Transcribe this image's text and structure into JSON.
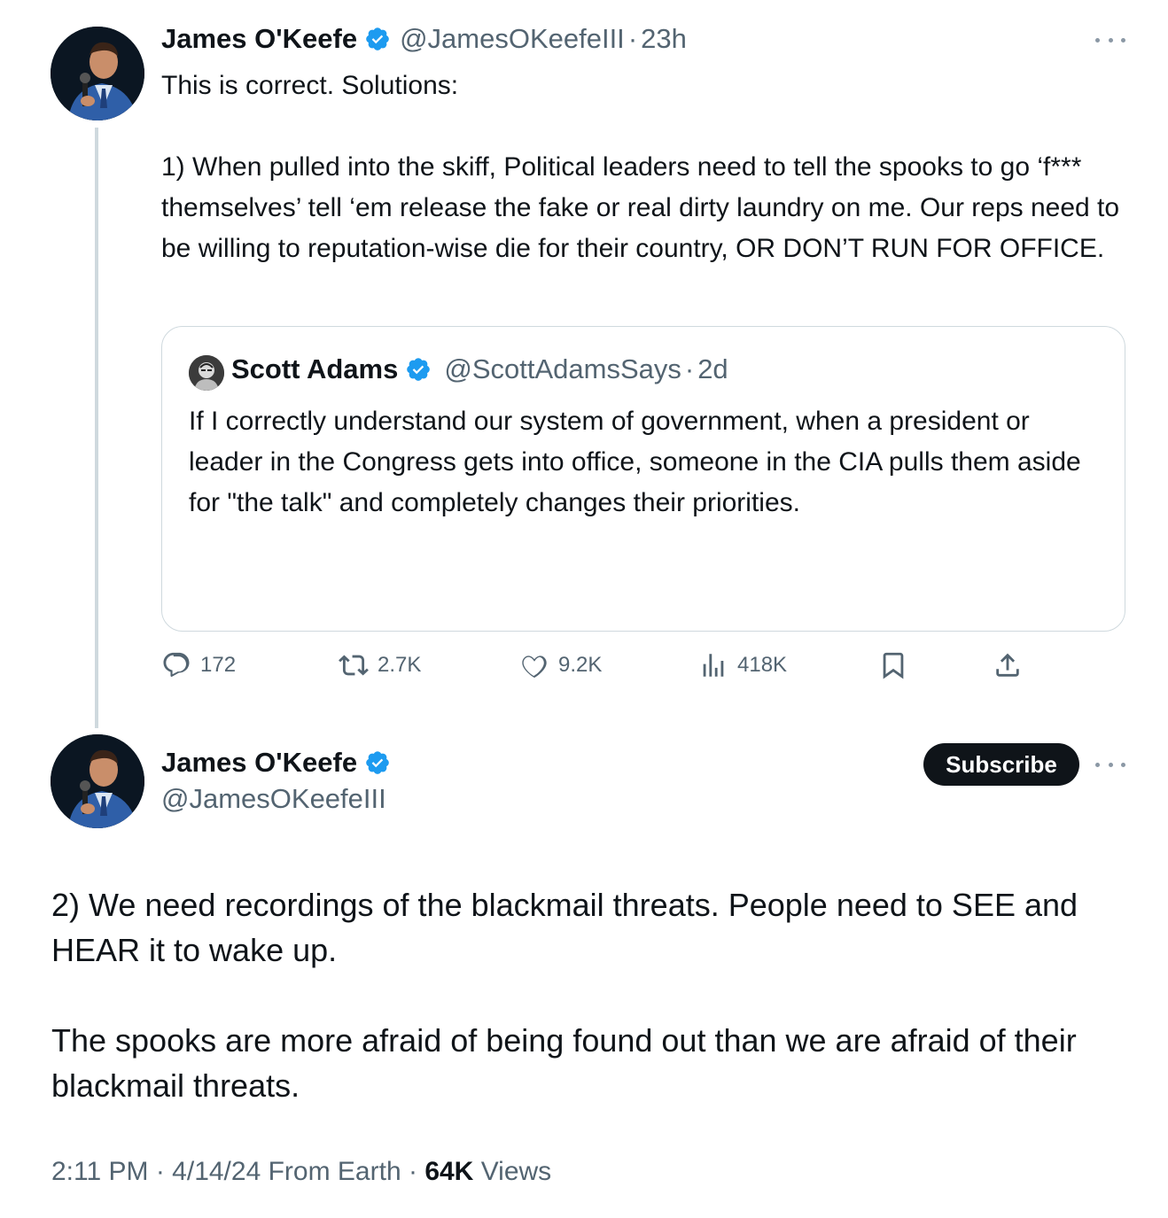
{
  "tweet1": {
    "author_name": "James O'Keefe",
    "handle": "@JamesOKeefeIII",
    "separator": "·",
    "time": "23h",
    "text": "This is correct. Solutions:\n\n1) When pulled into the skiff, Political leaders need to tell the spooks to go ‘f*** themselves’ tell ‘em release the fake or real dirty laundry on me. Our reps need to be willing to reputation-wise die for their country, OR DON’T RUN FOR OFFICE.",
    "quote": {
      "author_name": "Scott Adams",
      "handle": "@ScottAdamsSays",
      "separator": "·",
      "time": "2d",
      "text": "If I correctly understand our system of government, when a president or leader in the Congress gets into office, someone in the CIA pulls them aside for \"the talk\" and completely changes their priorities."
    },
    "actions": {
      "replies": "172",
      "reposts": "2.7K",
      "likes": "9.2K",
      "views": "418K"
    }
  },
  "tweet2": {
    "author_name": "James O'Keefe",
    "handle": "@JamesOKeefeIII",
    "subscribe_label": "Subscribe",
    "paragraphs": [
      "2) We need recordings of the blackmail threats. People need to SEE and HEAR it to wake up.",
      "The spooks are more afraid of being found out than we are afraid of their blackmail threats."
    ],
    "footer": {
      "time": "2:11 PM",
      "sep1": " · ",
      "date": "4/14/24",
      "source": " From Earth",
      "sep2": " · ",
      "views_count": "64K",
      "views_label": " Views"
    }
  },
  "colors": {
    "verified_blue": "#1d9bf0",
    "text_primary": "#0f1419",
    "text_secondary": "#536471",
    "border": "#cfd9de",
    "subscribe_bg": "#0f1419"
  },
  "icons": {
    "verified": "verified-badge-icon",
    "more": "more-dots-icon",
    "reply": "reply-icon",
    "repost": "repost-icon",
    "like": "heart-icon",
    "views": "views-chart-icon",
    "bookmark": "bookmark-icon",
    "share": "share-icon"
  }
}
